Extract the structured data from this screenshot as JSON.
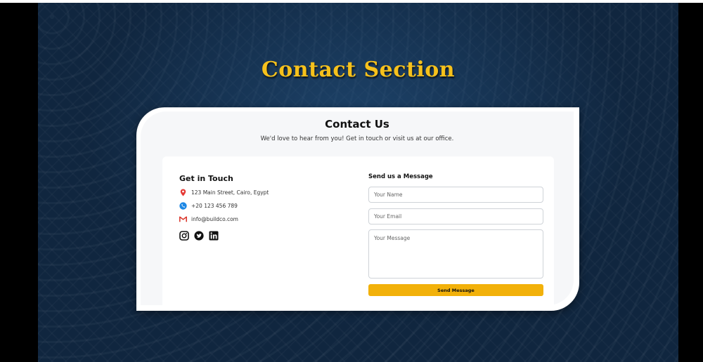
{
  "hero": {
    "title": "Contact Section"
  },
  "contact": {
    "title": "Contact Us",
    "subtitle": "We'd love to hear from you! Get in touch or visit us at our office."
  },
  "get_in_touch": {
    "title": "Get in Touch",
    "address": "123 Main Street, Cairo, Egypt",
    "phone": "+20 123 456 789",
    "email": "info@buildco.com",
    "socials": [
      "instagram-icon",
      "twitter-icon",
      "linkedin-icon"
    ]
  },
  "form": {
    "title": "Send us a Message",
    "name_placeholder": "Your Name",
    "email_placeholder": "Your Email",
    "message_placeholder": "Your Message",
    "submit_label": "Send Message"
  },
  "colors": {
    "accent": "#f2b10a",
    "title_gold": "#f6c11c",
    "hero_bg": "#10263f",
    "pin_red": "#e53935",
    "phone_blue": "#1e88e5"
  }
}
